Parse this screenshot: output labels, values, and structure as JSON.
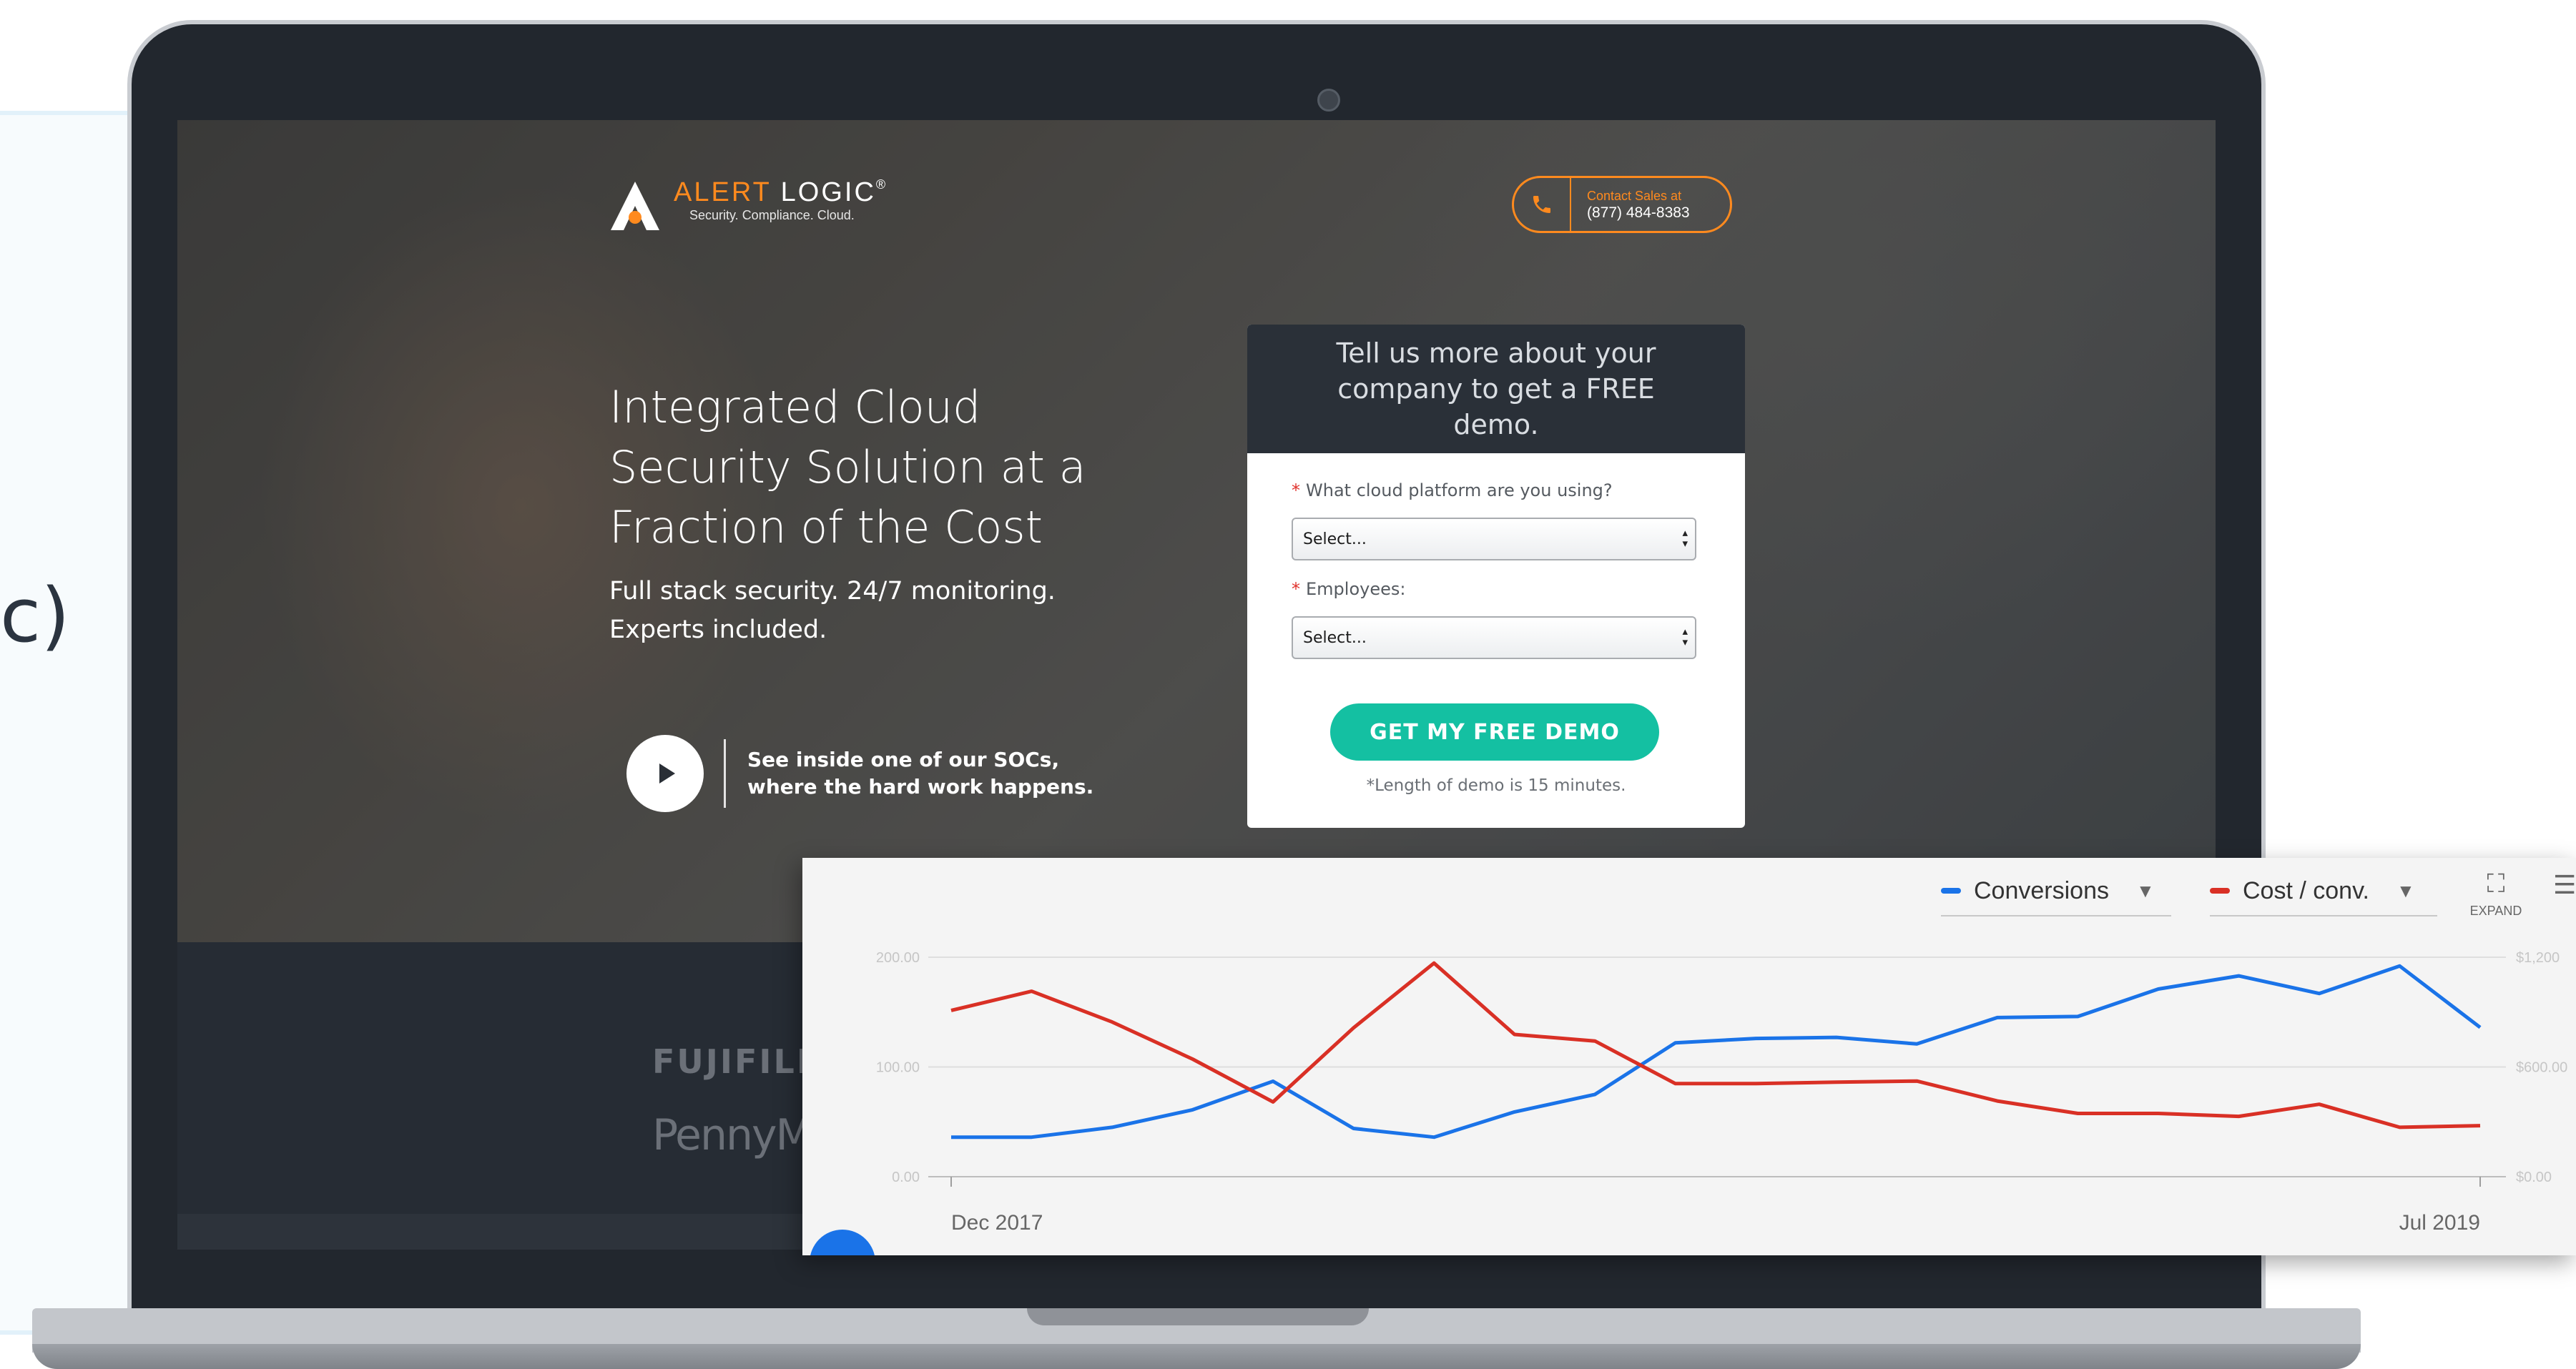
{
  "background": {
    "partial_text": "c)"
  },
  "site": {
    "logo": {
      "name_accent": "ALERT",
      "name_main": "LOGIC",
      "mark": "®",
      "tagline": "Security. Compliance. Cloud."
    },
    "contact": {
      "label": "Contact Sales at",
      "phone": "(877) 484-8383",
      "icon": "phone-icon"
    },
    "hero": {
      "headline_lines": [
        "Integrated Cloud",
        "Security Solution at a",
        "Fraction of the Cost"
      ],
      "sub_lines": [
        "Full stack security. 24/7 monitoring.",
        "Experts included."
      ],
      "video_lines": [
        "See inside one of our SOCs,",
        "where the hard work happens."
      ]
    },
    "form": {
      "heading_lines": [
        "Tell us more about your",
        "company to get a FREE demo."
      ],
      "required_mark": "*",
      "q1_label": "What cloud platform are you using?",
      "q1_value": "Select...",
      "q2_label": "Employees:",
      "q2_value": "Select...",
      "cta": "GET MY FREE DEMO",
      "note": "*Length of demo is 15 minutes."
    },
    "clients": [
      "FUJIFILM",
      "PennyMac"
    ]
  },
  "chart_panel": {
    "metric1": "Conversions",
    "metric2": "Cost / conv.",
    "expand_label": "EXPAND",
    "colors": {
      "conversions": "#1a73e8",
      "cost": "#d93025"
    }
  },
  "chart_data": {
    "type": "line",
    "x_start_label": "Dec 2017",
    "x_end_label": "Jul 2019",
    "left_axis_ticks": [
      "200.00",
      "100.00",
      "0.00"
    ],
    "right_axis_ticks": [
      "$1,200",
      "$600.00",
      "$0.00"
    ],
    "series": [
      {
        "name": "Conversions",
        "color": "#1a73e8",
        "values": [
          36,
          36,
          45,
          61,
          87,
          44,
          36,
          59,
          75,
          122,
          126,
          127,
          121,
          145,
          146,
          171,
          183,
          167,
          192,
          136
        ]
      },
      {
        "name": "Cost / conv.",
        "color": "#d93025",
        "values": [
          909,
          1014,
          846,
          643,
          409,
          814,
          1168,
          778,
          742,
          509,
          509,
          517,
          523,
          414,
          346,
          346,
          330,
          396,
          270,
          279
        ]
      }
    ],
    "left_ylim": [
      0,
      200
    ],
    "right_ylim": [
      0,
      1200
    ],
    "grid": true
  }
}
